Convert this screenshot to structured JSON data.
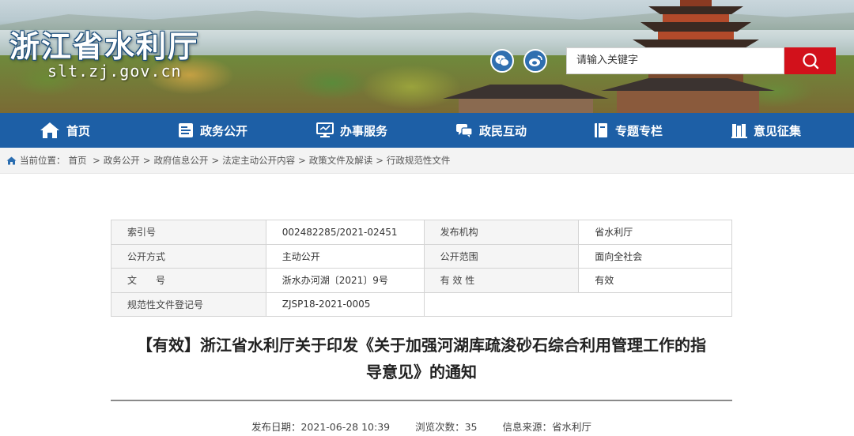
{
  "site": {
    "logo_cn": "浙江省水利厅",
    "logo_en": "slt.zj.gov.cn"
  },
  "search": {
    "placeholder": "请输入关键字"
  },
  "nav": {
    "items": [
      {
        "label": "首页",
        "icon": "home-icon"
      },
      {
        "label": "政务公开",
        "icon": "document-icon"
      },
      {
        "label": "办事服务",
        "icon": "monitor-icon"
      },
      {
        "label": "政民互动",
        "icon": "chat-icon"
      },
      {
        "label": "专题专栏",
        "icon": "book-icon"
      },
      {
        "label": "意见征集",
        "icon": "books-icon"
      }
    ]
  },
  "breadcrumb": {
    "prefix": "当前位置：",
    "items": [
      "首页",
      "政务公开",
      "政府信息公开",
      "法定主动公开内容",
      "政策文件及解读",
      "行政规范性文件"
    ]
  },
  "info": {
    "index_label": "索引号",
    "index_value": "002482285/2021-02451",
    "publisher_label": "发布机构",
    "publisher_value": "省水利厅",
    "mode_label": "公开方式",
    "mode_value": "主动公开",
    "scope_label": "公开范围",
    "scope_value": "面向全社会",
    "docno_label": "文　　号",
    "docno_value": "浙水办河湖〔2021〕9号",
    "validity_label": "有 效 性",
    "validity_value": "有效",
    "reg_label": "规范性文件登记号",
    "reg_value": "ZJSP18-2021-0005"
  },
  "doc": {
    "title_line1": "【有效】浙江省水利厅关于印发《关于加强河湖库疏浚砂石综合利用管理工作的指",
    "title_line2": "导意见》的通知",
    "date_label": "发布日期：",
    "date_value": "2021-06-28 10:39",
    "views_label": "浏览次数：",
    "views_value": "35",
    "source_label": "信息来源：",
    "source_value": "省水利厅"
  },
  "colors": {
    "nav_blue": "#1d5fa6",
    "search_red": "#d2111b"
  }
}
